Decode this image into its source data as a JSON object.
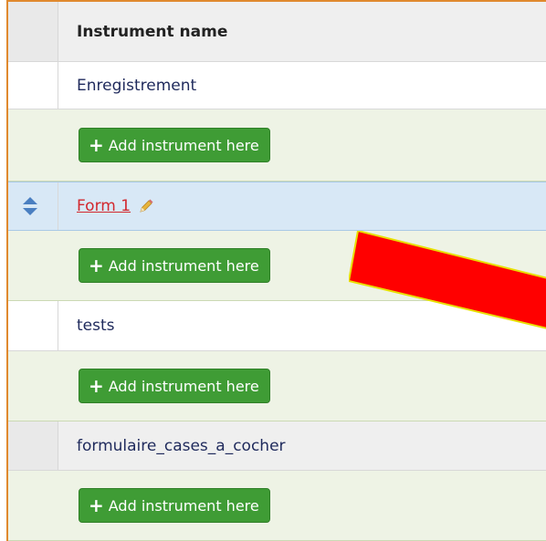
{
  "table": {
    "header": {
      "label": "Instrument name"
    },
    "add_button_label": "Add instrument here",
    "instruments": [
      {
        "name": "Enregistrement"
      },
      {
        "name": "Form 1"
      },
      {
        "name": "tests"
      },
      {
        "name": "formulaire_cases_a_cocher"
      }
    ]
  },
  "icons": {
    "add": "plus-icon",
    "reorder": "up-down-arrows-icon",
    "edit": "pencil-icon",
    "annotation": "red-arrow-annotation"
  },
  "colors": {
    "frame_border": "#e0892e",
    "add_button_bg": "#3f9c35",
    "add_row_bg": "#eef3e5",
    "selected_row_bg": "#d8e8f6",
    "link_red": "#d2282e",
    "annotation_red": "#ff0000",
    "annotation_outline": "#e8e000"
  }
}
